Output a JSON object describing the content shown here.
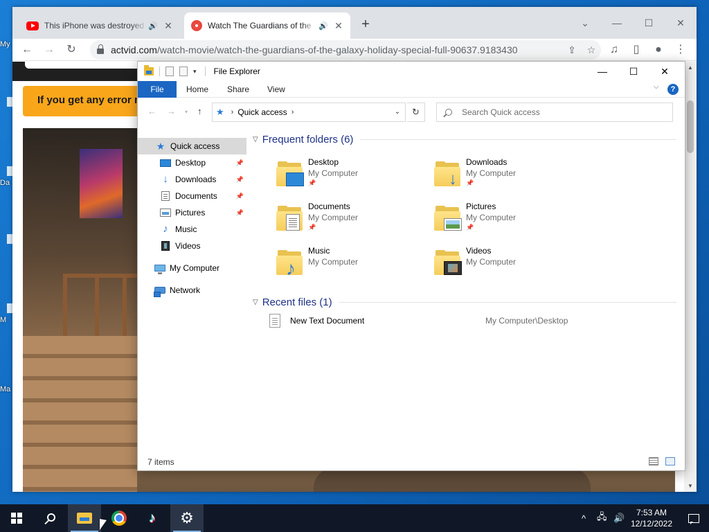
{
  "desktop": {
    "labels": [
      "My",
      "Da",
      "M",
      "Ma"
    ]
  },
  "browser": {
    "tabs": [
      {
        "title": "This iPhone was destroyed in",
        "audio": "🔊",
        "close": "✕"
      },
      {
        "title": "Watch The Guardians of the",
        "audio": "🔊",
        "close": "✕"
      }
    ],
    "new_tab": "+",
    "controls": {
      "tab_search": "⌄",
      "minimize": "—",
      "maximize": "☐",
      "close": "✕"
    },
    "nav": {
      "back": "←",
      "forward": "→",
      "reload": "↻"
    },
    "url_host": "actvid.com",
    "url_path": "/watch-movie/watch-the-guardians-of-the-galaxy-holiday-special-full-90637.9183430",
    "actions": {
      "share": "⇪",
      "bookmark": "☆",
      "media": "♫",
      "sidepanel": "▯",
      "profile": "●",
      "menu": "⋮"
    }
  },
  "page": {
    "banner_text": "If you get any error message"
  },
  "explorer": {
    "title": "File Explorer",
    "controls": {
      "minimize": "—",
      "maximize": "☐",
      "close": "✕"
    },
    "ribbon_tabs": [
      "File",
      "Home",
      "Share",
      "View"
    ],
    "help": "?",
    "address": {
      "location": "Quick access"
    },
    "search_placeholder": "Search Quick access",
    "sidebar": [
      {
        "label": "Quick access",
        "icon": "star-icon",
        "pinned": false,
        "selected": true
      },
      {
        "label": "Desktop",
        "icon": "desktop-icon",
        "pinned": true
      },
      {
        "label": "Downloads",
        "icon": "download-icon",
        "pinned": true
      },
      {
        "label": "Documents",
        "icon": "document-icon",
        "pinned": true
      },
      {
        "label": "Pictures",
        "icon": "pictures-icon",
        "pinned": true
      },
      {
        "label": "Music",
        "icon": "music-icon",
        "pinned": false
      },
      {
        "label": "Videos",
        "icon": "videos-icon",
        "pinned": false
      },
      {
        "label": "My Computer",
        "icon": "computer-icon",
        "pinned": false
      },
      {
        "label": "Network",
        "icon": "network-icon",
        "pinned": false
      }
    ],
    "frequent_header": "Frequent folders (6)",
    "frequent": [
      {
        "name": "Desktop",
        "location": "My Computer",
        "pinned": true
      },
      {
        "name": "Downloads",
        "location": "My Computer",
        "pinned": true
      },
      {
        "name": "Documents",
        "location": "My Computer",
        "pinned": true
      },
      {
        "name": "Pictures",
        "location": "My Computer",
        "pinned": true
      },
      {
        "name": "Music",
        "location": "My Computer",
        "pinned": false
      },
      {
        "name": "Videos",
        "location": "My Computer",
        "pinned": false
      }
    ],
    "recent_header": "Recent files (1)",
    "recent": [
      {
        "name": "New Text Document",
        "path": "My Computer\\Desktop"
      }
    ],
    "status": "7 items"
  },
  "taskbar": {
    "time": "7:53 AM",
    "date": "12/12/2022",
    "tray": {
      "chevron": "^",
      "network": "🖧",
      "volume": "🔊"
    }
  }
}
